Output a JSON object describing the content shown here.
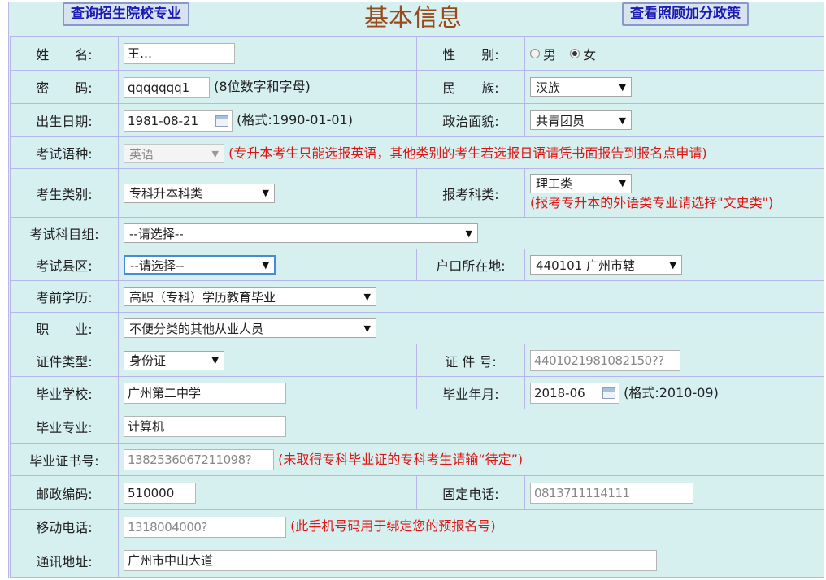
{
  "page": {
    "title": "基本信息",
    "btn_left": "查询招生院校专业",
    "btn_right": "查看照顾加分政策"
  },
  "fields": {
    "name": {
      "label": "姓　　名:",
      "value": "王…"
    },
    "gender": {
      "label": "性　　别:",
      "options": [
        "男",
        "女"
      ],
      "selected": "女"
    },
    "password": {
      "label": "密　　码:",
      "value": "qqqqqqq1",
      "hint": "(8位数字和字母)"
    },
    "ethnicity": {
      "label": "民　　族:",
      "value": "汉族"
    },
    "birthdate": {
      "label": "出生日期:",
      "value": "1981-08-21",
      "hint": "(格式:1990-01-01)"
    },
    "political": {
      "label": "政治面貌:",
      "value": "共青团员"
    },
    "exam_language": {
      "label": "考试语种:",
      "value": "英语",
      "note": "(专升本考生只能选报英语，其他类别的考生若选报日语请凭书面报告到报名点申请)"
    },
    "candidate_type": {
      "label": "考生类别:",
      "value": "专科升本科类"
    },
    "subject_category": {
      "label": "报考科类:",
      "value": "理工类",
      "note": "(报考专升本的外语类专业请选择\"文史类\")"
    },
    "subject_group": {
      "label": "考试科目组:",
      "value": "--请选择--"
    },
    "exam_county": {
      "label": "考试县区:",
      "value": "--请选择--"
    },
    "household": {
      "label": "户口所在地:",
      "value": "440101 广州市辖"
    },
    "education": {
      "label": "考前学历:",
      "value": "高职（专科）学历教育毕业"
    },
    "occupation": {
      "label": "职　　业:",
      "value": "不便分类的其他从业人员"
    },
    "id_type": {
      "label": "证件类型:",
      "value": "身份证"
    },
    "id_number": {
      "label": "证 件 号:",
      "value": "4401021981082150??"
    },
    "school": {
      "label": "毕业学校:",
      "value": "广州第二中学"
    },
    "grad_date": {
      "label": "毕业年月:",
      "value": "2018-06",
      "hint": "(格式:2010-09)"
    },
    "major": {
      "label": "毕业专业:",
      "value": "计算机"
    },
    "certificate": {
      "label": "毕业证书号:",
      "value": "1382536067211098?",
      "note": "(未取得专科毕业证的专科考生请输“待定”)"
    },
    "postcode": {
      "label": "邮政编码:",
      "value": "510000"
    },
    "phone": {
      "label": "固定电话:",
      "value": "0813711114111"
    },
    "mobile": {
      "label": "移动电话:",
      "value": "1318004000?",
      "note": "(此手机号码用于绑定您的预报名号)"
    },
    "address": {
      "label": "通讯地址:",
      "value": "广州市中山大道"
    }
  },
  "colors": {
    "bg": "#d6efef",
    "border": "#b6b6ea",
    "title": "#9a4b1e",
    "note": "#e01414",
    "button_text": "#1a1ab4"
  }
}
